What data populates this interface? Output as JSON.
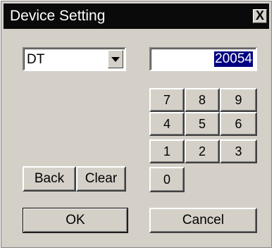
{
  "window": {
    "title": "Device Setting",
    "close_label": "X"
  },
  "device_select": {
    "selected": "DT"
  },
  "value_field": {
    "value": "20054"
  },
  "keypad": {
    "keys": [
      "7",
      "8",
      "9",
      "4",
      "5",
      "6",
      "1",
      "2",
      "3",
      "0"
    ]
  },
  "buttons": {
    "back": "Back",
    "clear": "Clear",
    "ok": "OK",
    "cancel": "Cancel"
  }
}
